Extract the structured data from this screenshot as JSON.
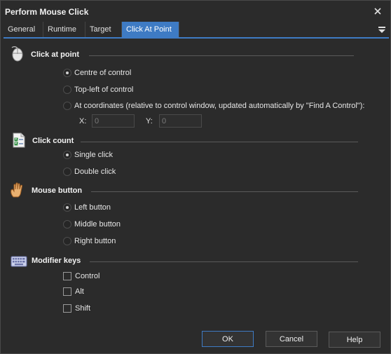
{
  "window": {
    "title": "Perform Mouse Click"
  },
  "tabs": [
    {
      "label": "General"
    },
    {
      "label": "Runtime"
    },
    {
      "label": "Target"
    },
    {
      "label": "Click At Point",
      "active": true
    }
  ],
  "click_at_point": {
    "title": "Click at point",
    "options": [
      {
        "label": "Centre of control",
        "checked": true
      },
      {
        "label": "Top-left of control",
        "checked": false
      },
      {
        "label": "At coordinates (relative to control window, updated automatically by \"Find A Control\"):",
        "checked": false
      }
    ],
    "x_label": "X:",
    "x_value": "0",
    "y_label": "Y:",
    "y_value": "0"
  },
  "click_count": {
    "title": "Click count",
    "options": [
      {
        "label": "Single click",
        "checked": true
      },
      {
        "label": "Double click",
        "checked": false
      }
    ]
  },
  "mouse_button": {
    "title": "Mouse button",
    "options": [
      {
        "label": "Left button",
        "checked": true
      },
      {
        "label": "Middle button",
        "checked": false
      },
      {
        "label": "Right button",
        "checked": false
      }
    ]
  },
  "modifier_keys": {
    "title": "Modifier keys",
    "options": [
      {
        "label": "Control",
        "checked": false
      },
      {
        "label": "Alt",
        "checked": false
      },
      {
        "label": "Shift",
        "checked": false
      }
    ]
  },
  "buttons": {
    "ok": "OK",
    "cancel": "Cancel",
    "help": "Help"
  },
  "colors": {
    "background": "#2b2b2b",
    "accent": "#3e7bc4",
    "text": "#e8e8e8"
  },
  "icons": {
    "close": "close-icon",
    "tab_menu": "menu-down-icon",
    "mouse": "mouse-icon",
    "checklist": "checklist-icon",
    "hand": "hand-icon",
    "keyboard": "keyboard-icon"
  }
}
